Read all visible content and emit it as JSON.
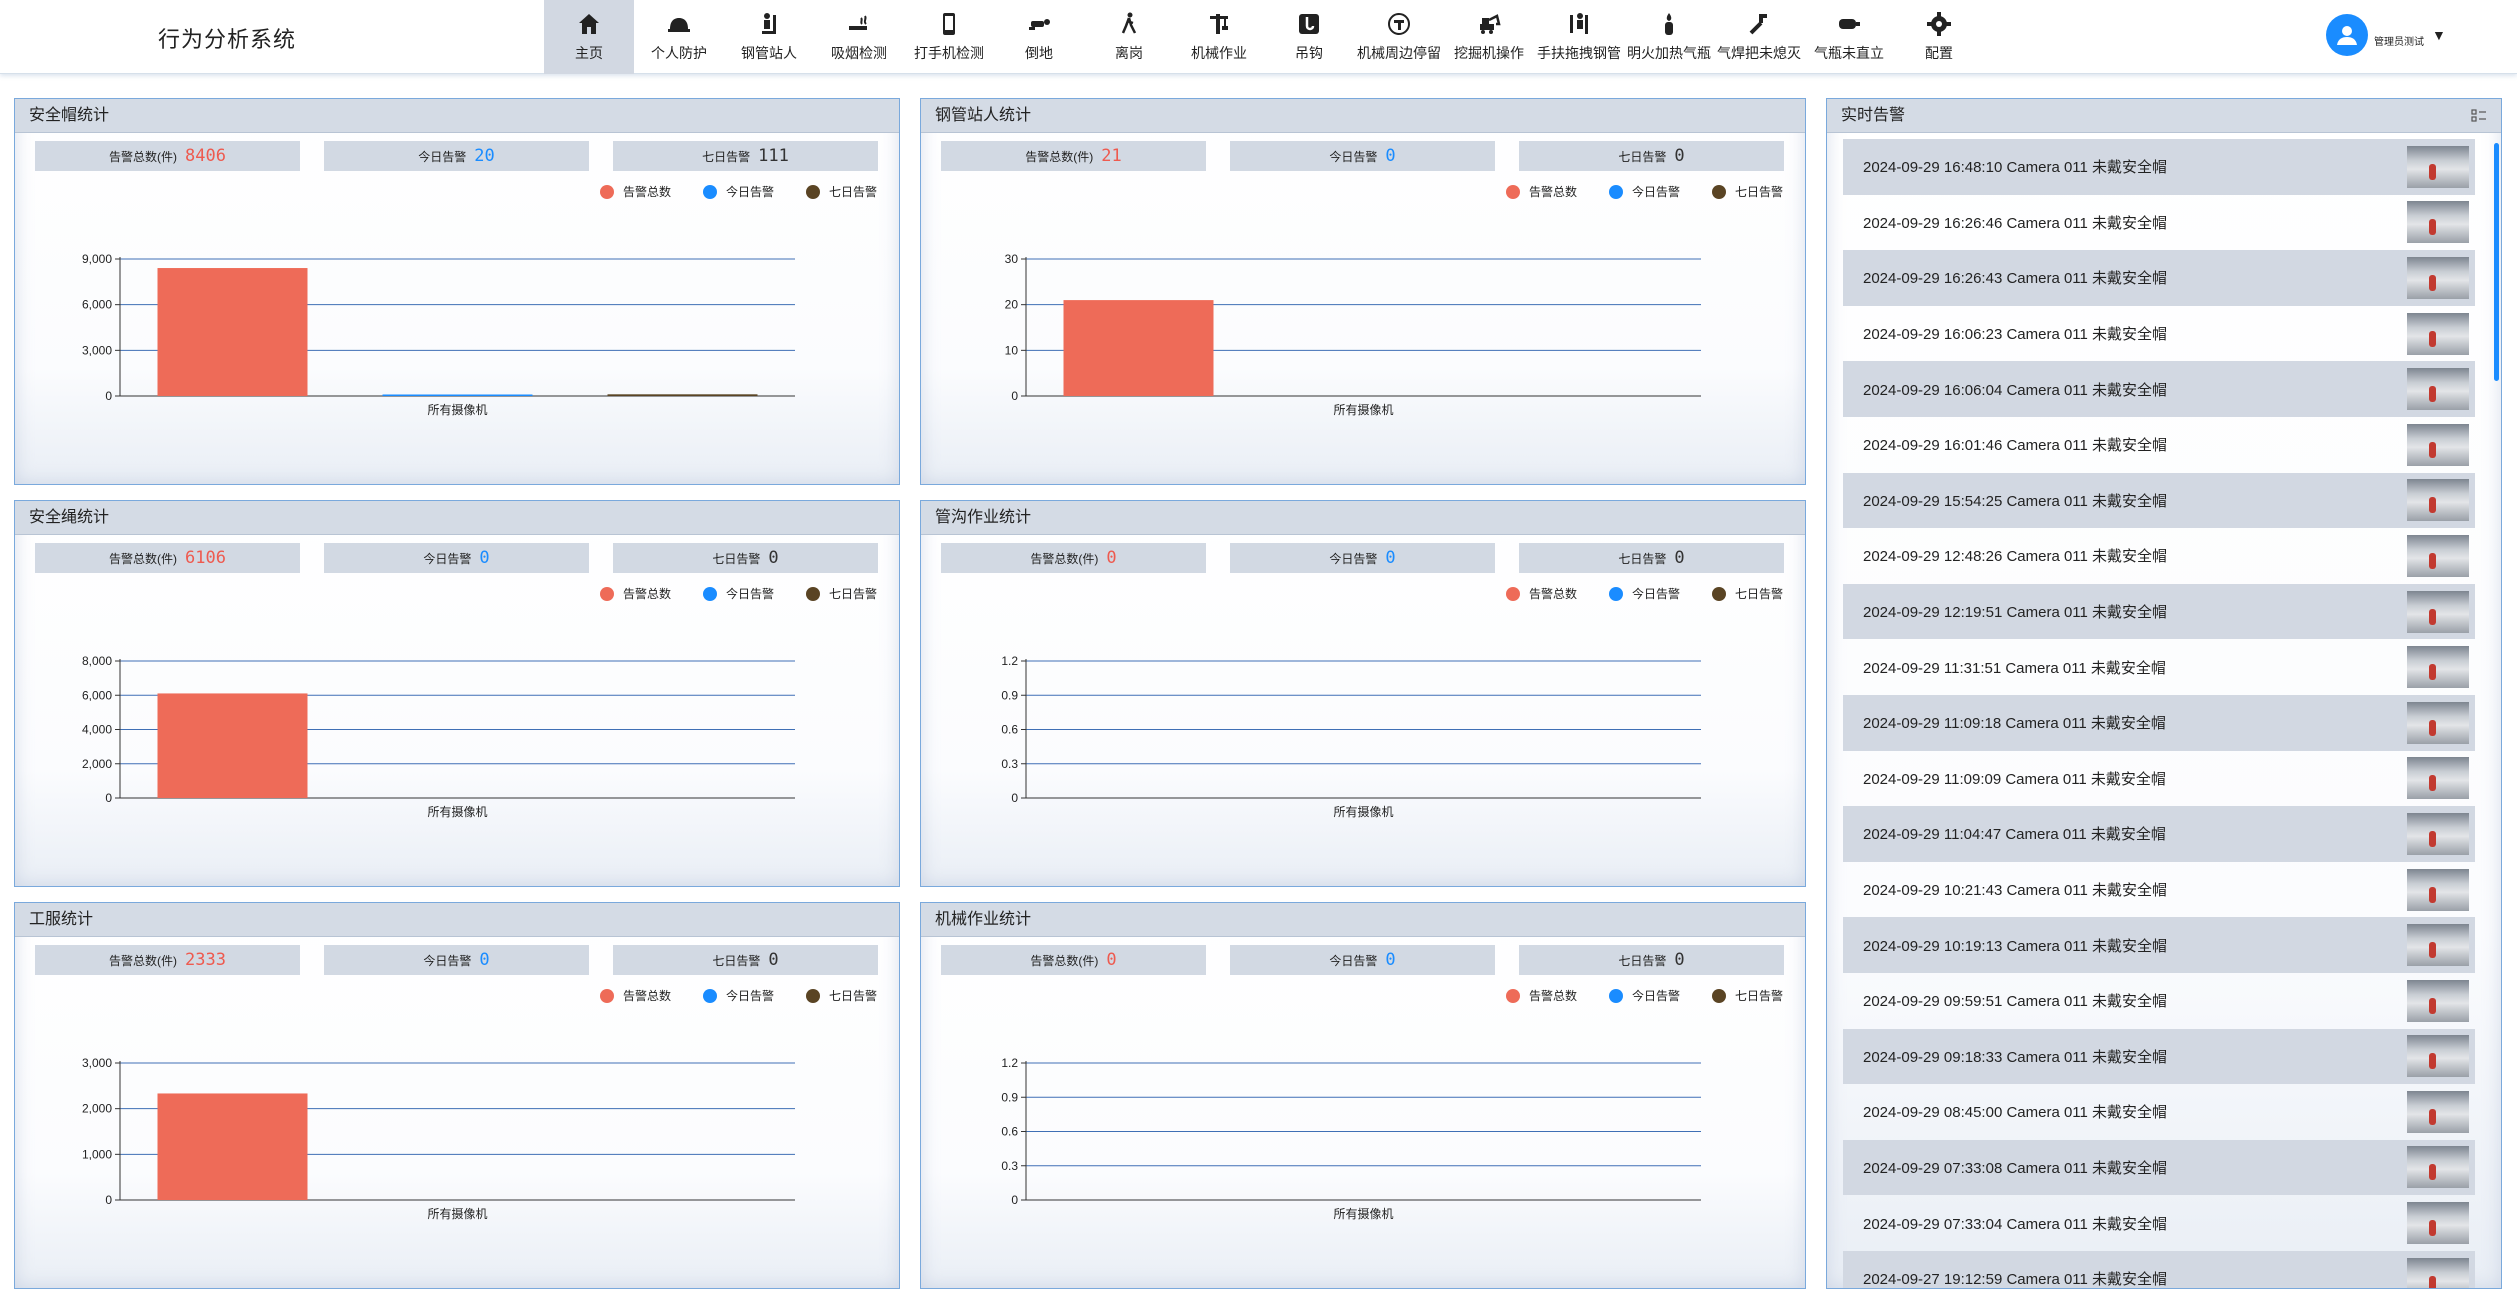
{
  "app": {
    "title": "行为分析系统"
  },
  "nav": [
    {
      "label": "主页",
      "icon": "home-icon",
      "active": true
    },
    {
      "label": "个人防护",
      "icon": "helmet-icon"
    },
    {
      "label": "钢管站人",
      "icon": "person-pipe-icon"
    },
    {
      "label": "吸烟检测",
      "icon": "cigarette-icon"
    },
    {
      "label": "打手机检测",
      "icon": "phone-icon"
    },
    {
      "label": "倒地",
      "icon": "fallen-person-icon"
    },
    {
      "label": "离岗",
      "icon": "walking-person-icon"
    },
    {
      "label": "机械作业",
      "icon": "crane-icon"
    },
    {
      "label": "吊钩",
      "icon": "hook-icon"
    },
    {
      "label": "机械周边停留",
      "icon": "restricted-zone-icon"
    },
    {
      "label": "挖掘机操作",
      "icon": "excavator-icon"
    },
    {
      "label": "手扶拖拽钢管",
      "icon": "drag-pipe-icon"
    },
    {
      "label": "明火加热气瓶",
      "icon": "flame-bottle-icon"
    },
    {
      "label": "气焊把未熄灭",
      "icon": "welding-torch-icon"
    },
    {
      "label": "气瓶未直立",
      "icon": "gas-cylinder-icon"
    },
    {
      "label": "配置",
      "icon": "gear-icon"
    }
  ],
  "user": {
    "name": "管理员测试"
  },
  "labels": {
    "total": "告警总数(件)",
    "today": "今日告警",
    "week": "七日告警",
    "x_category": "所有摄像机"
  },
  "legend": [
    {
      "label": "告警总数",
      "color": "#ee6b58"
    },
    {
      "label": "今日告警",
      "color": "#1a8cff"
    },
    {
      "label": "七日告警",
      "color": "#5a4424"
    }
  ],
  "panels": [
    {
      "title": "安全帽统计",
      "total": "8406",
      "today": "20",
      "week": "111"
    },
    {
      "title": "钢管站人统计",
      "total": "21",
      "today": "0",
      "week": "0"
    },
    {
      "title": "安全绳统计",
      "total": "6106",
      "today": "0",
      "week": "0"
    },
    {
      "title": "管沟作业统计",
      "total": "0",
      "today": "0",
      "week": "0"
    },
    {
      "title": "工服统计",
      "total": "2333",
      "today": "0",
      "week": "0"
    },
    {
      "title": "机械作业统计",
      "total": "0",
      "today": "0",
      "week": "0"
    }
  ],
  "chart_data": [
    {
      "type": "bar",
      "title": "安全帽统计",
      "categories": [
        "所有摄像机"
      ],
      "series": [
        {
          "name": "告警总数",
          "values": [
            8406
          ]
        },
        {
          "name": "今日告警",
          "values": [
            20
          ]
        },
        {
          "name": "七日告警",
          "values": [
            111
          ]
        }
      ],
      "ylim": [
        0,
        9000
      ],
      "ticks": [
        "0",
        "3,000",
        "6,000",
        "9,000"
      ],
      "legend_position": "top-right"
    },
    {
      "type": "bar",
      "title": "钢管站人统计",
      "categories": [
        "所有摄像机"
      ],
      "series": [
        {
          "name": "告警总数",
          "values": [
            21
          ]
        },
        {
          "name": "今日告警",
          "values": [
            0
          ]
        },
        {
          "name": "七日告警",
          "values": [
            0
          ]
        }
      ],
      "ylim": [
        0,
        30
      ],
      "ticks": [
        "0",
        "10",
        "20",
        "30"
      ],
      "legend_position": "top-right"
    },
    {
      "type": "bar",
      "title": "安全绳统计",
      "categories": [
        "所有摄像机"
      ],
      "series": [
        {
          "name": "告警总数",
          "values": [
            6106
          ]
        },
        {
          "name": "今日告警",
          "values": [
            0
          ]
        },
        {
          "name": "七日告警",
          "values": [
            0
          ]
        }
      ],
      "ylim": [
        0,
        8000
      ],
      "ticks": [
        "0",
        "2,000",
        "4,000",
        "6,000",
        "8,000"
      ],
      "legend_position": "top-right"
    },
    {
      "type": "bar",
      "title": "管沟作业统计",
      "categories": [
        "所有摄像机"
      ],
      "series": [
        {
          "name": "告警总数",
          "values": [
            0
          ]
        },
        {
          "name": "今日告警",
          "values": [
            0
          ]
        },
        {
          "name": "七日告警",
          "values": [
            0
          ]
        }
      ],
      "ylim": [
        0,
        1.2
      ],
      "ticks": [
        "0",
        "0.3",
        "0.6",
        "0.9",
        "1.2"
      ],
      "legend_position": "top-right"
    },
    {
      "type": "bar",
      "title": "工服统计",
      "categories": [
        "所有摄像机"
      ],
      "series": [
        {
          "name": "告警总数",
          "values": [
            2333
          ]
        },
        {
          "name": "今日告警",
          "values": [
            0
          ]
        },
        {
          "name": "七日告警",
          "values": [
            0
          ]
        }
      ],
      "ylim": [
        0,
        3000
      ],
      "ticks": [
        "0",
        "1,000",
        "2,000",
        "3,000"
      ],
      "legend_position": "top-right"
    },
    {
      "type": "bar",
      "title": "机械作业统计",
      "categories": [
        "所有摄像机"
      ],
      "series": [
        {
          "name": "告警总数",
          "values": [
            0
          ]
        },
        {
          "name": "今日告警",
          "values": [
            0
          ]
        },
        {
          "name": "七日告警",
          "values": [
            0
          ]
        }
      ],
      "ylim": [
        0,
        1.2
      ],
      "ticks": [
        "0",
        "0.3",
        "0.6",
        "0.9",
        "1.2"
      ],
      "legend_position": "top-right"
    }
  ],
  "alerts": {
    "title": "实时告警",
    "items": [
      "2024-09-29 16:48:10 Camera 011 未戴安全帽",
      "2024-09-29 16:26:46 Camera 011 未戴安全帽",
      "2024-09-29 16:26:43 Camera 011 未戴安全帽",
      "2024-09-29 16:06:23 Camera 011 未戴安全帽",
      "2024-09-29 16:06:04 Camera 011 未戴安全帽",
      "2024-09-29 16:01:46 Camera 011 未戴安全帽",
      "2024-09-29 15:54:25 Camera 011 未戴安全帽",
      "2024-09-29 12:48:26 Camera 011 未戴安全帽",
      "2024-09-29 12:19:51 Camera 011 未戴安全帽",
      "2024-09-29 11:31:51 Camera 011 未戴安全帽",
      "2024-09-29 11:09:18 Camera 011 未戴安全帽",
      "2024-09-29 11:09:09 Camera 011 未戴安全帽",
      "2024-09-29 11:04:47 Camera 011 未戴安全帽",
      "2024-09-29 10:21:43 Camera 011 未戴安全帽",
      "2024-09-29 10:19:13 Camera 011 未戴安全帽",
      "2024-09-29 09:59:51 Camera 011 未戴安全帽",
      "2024-09-29 09:18:33 Camera 011 未戴安全帽",
      "2024-09-29 08:45:00 Camera 011 未戴安全帽",
      "2024-09-29 07:33:08 Camera 011 未戴安全帽",
      "2024-09-29 07:33:04 Camera 011 未戴安全帽",
      "2024-09-27 19:12:59 Camera 011 未戴安全帽"
    ]
  }
}
